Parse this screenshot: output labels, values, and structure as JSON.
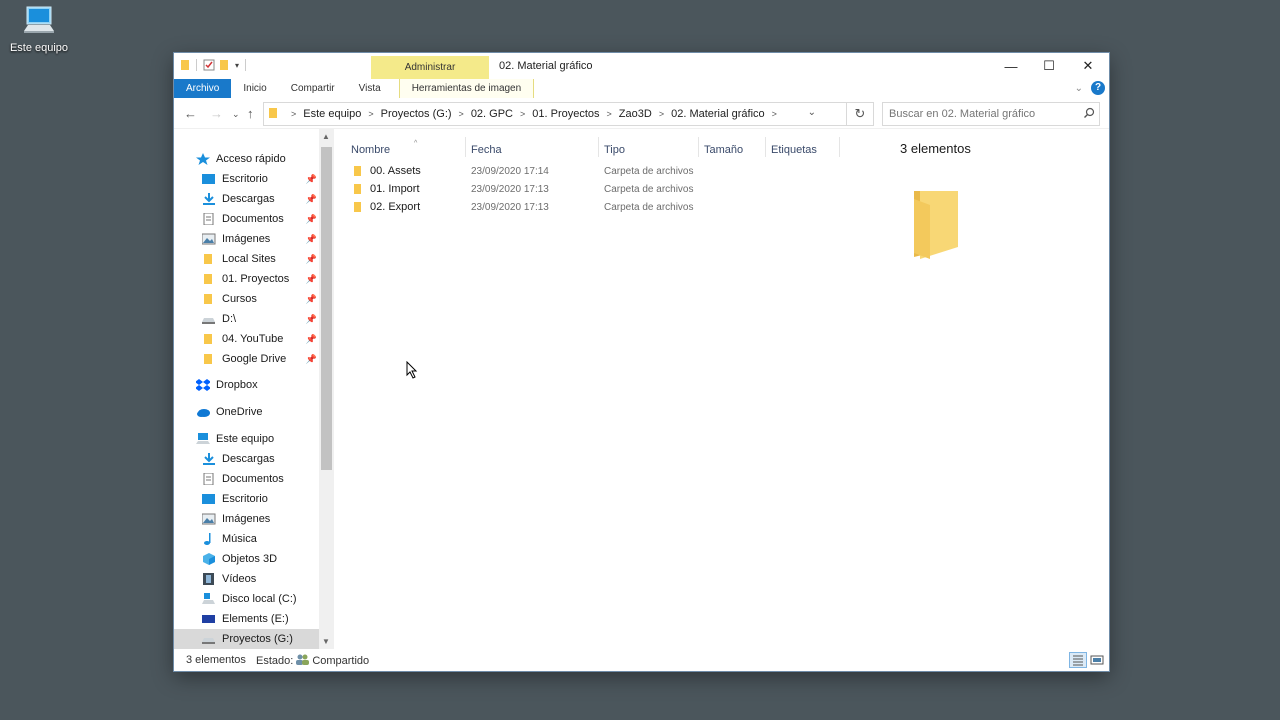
{
  "desktop": {
    "icon_label": "Este equipo"
  },
  "window": {
    "title": "02. Material gráfico",
    "context_tab_group": "Administrar",
    "controls": {
      "minimize": "—",
      "maximize": "☐",
      "close": "✕"
    }
  },
  "ribbon": {
    "tabs": [
      "Archivo",
      "Inicio",
      "Compartir",
      "Vista",
      "Herramientas de imagen"
    ],
    "help": "?"
  },
  "address": {
    "crumbs": [
      "Este equipo",
      "Proyectos (G:)",
      "02. GPC",
      "01. Proyectos",
      "Zao3D",
      "02. Material gráfico"
    ],
    "search_placeholder": "Buscar en 02. Material gráfico"
  },
  "nav": {
    "quick_access": "Acceso rápido",
    "quick_items": [
      "Escritorio",
      "Descargas",
      "Documentos",
      "Imágenes",
      "Local Sites",
      "01. Proyectos",
      "Cursos",
      "D:\\",
      "04. YouTube",
      "Google Drive"
    ],
    "dropbox": "Dropbox",
    "onedrive": "OneDrive",
    "this_pc": "Este equipo",
    "pc_items": [
      "Descargas",
      "Documentos",
      "Escritorio",
      "Imágenes",
      "Música",
      "Objetos 3D",
      "Vídeos",
      "Disco local (C:)",
      "Elements (E:)",
      "Proyectos (G:)"
    ]
  },
  "columns": [
    "Nombre",
    "Fecha",
    "Tipo",
    "Tamaño",
    "Etiquetas"
  ],
  "files": [
    {
      "name": "00. Assets",
      "date": "23/09/2020 17:14",
      "type": "Carpeta de archivos"
    },
    {
      "name": "01. Import",
      "date": "23/09/2020 17:13",
      "type": "Carpeta de archivos"
    },
    {
      "name": "02. Export",
      "date": "23/09/2020 17:13",
      "type": "Carpeta de archivos"
    }
  ],
  "preview": {
    "count_text": "3 elementos"
  },
  "status": {
    "count": "3 elementos",
    "state_label": "Estado:",
    "state_value": "Compartido"
  },
  "colors": {
    "accent": "#1979ca",
    "context_tab": "#f4ea8a",
    "folder": "#f8d775",
    "desktop": "#4b565c"
  }
}
